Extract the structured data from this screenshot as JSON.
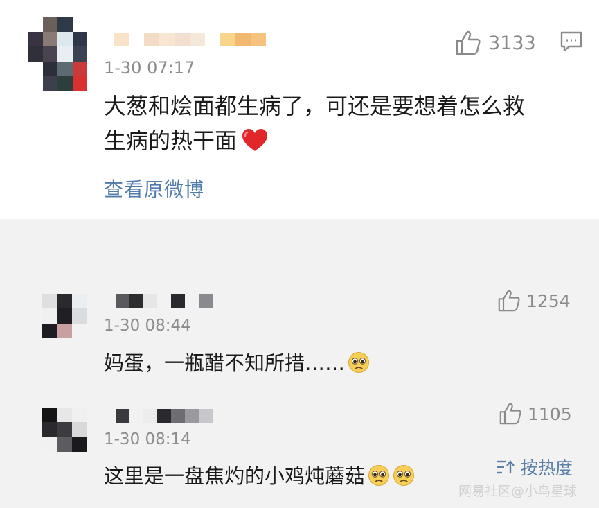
{
  "post": {
    "time": "1-30 07:17",
    "text_line1": "大葱和烩面都生病了，可还是要想着怎么救",
    "text_line2": "生病的热干面",
    "like_count": "3133",
    "view_original": "查看原微博"
  },
  "sort_label": "按热度",
  "comments": [
    {
      "time": "1-30 08:44",
      "text": "妈蛋，一瓶醋不知所措……",
      "like_count": "1254"
    },
    {
      "time": "1-30 08:14",
      "text": "这里是一盘焦灼的小鸡炖蘑菇",
      "like_count": "1105"
    }
  ],
  "watermark": "网易社区@小鸟星球",
  "icons": {
    "like": "thumbs-up-icon",
    "comment": "comment-bubble-icon",
    "heart": "red-heart-emoji",
    "face": "pleading-face-emoji",
    "sort": "sort-icon"
  }
}
